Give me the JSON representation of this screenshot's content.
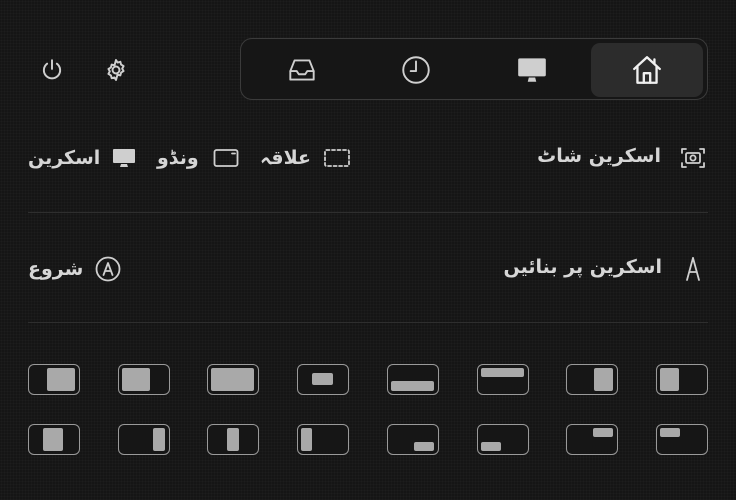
{
  "header": {
    "icons": [
      "power-icon",
      "gear-icon"
    ],
    "tabs": [
      {
        "name": "tab-inbox",
        "icon": "inbox-icon"
      },
      {
        "name": "tab-history",
        "icon": "clock-icon"
      },
      {
        "name": "tab-display",
        "icon": "monitor-icon"
      },
      {
        "name": "tab-home",
        "icon": "home-icon",
        "active": true
      }
    ]
  },
  "screenshot": {
    "title": "اسکرین شاٹ",
    "icon": "camera-icon",
    "options": {
      "area": "علاقہ",
      "window": "ونڈو",
      "screen": "اسکرین"
    }
  },
  "recording": {
    "title": "اسکرین پر بنائیں",
    "icon": "pen-nib-icon",
    "start": "شروع",
    "start_icon": "circled-a-icon"
  },
  "layouts": {
    "row1": [
      "left-half",
      "right-half",
      "left-wide",
      "fullscreen",
      "center-small",
      "bottom-wide",
      "top-strip",
      "right-third"
    ],
    "row2": [
      "left-third",
      "right-narrow",
      "center-narrow",
      "left-narrow",
      "bottom-right-quarter",
      "bottom-left-quarter",
      "top-right-quarter",
      "top-left-quarter"
    ]
  },
  "colors": {
    "background": "#151515",
    "active_tab": "#2c2c2c",
    "text": "#d6d6d6",
    "layout_fill": "#a9a9a9"
  }
}
